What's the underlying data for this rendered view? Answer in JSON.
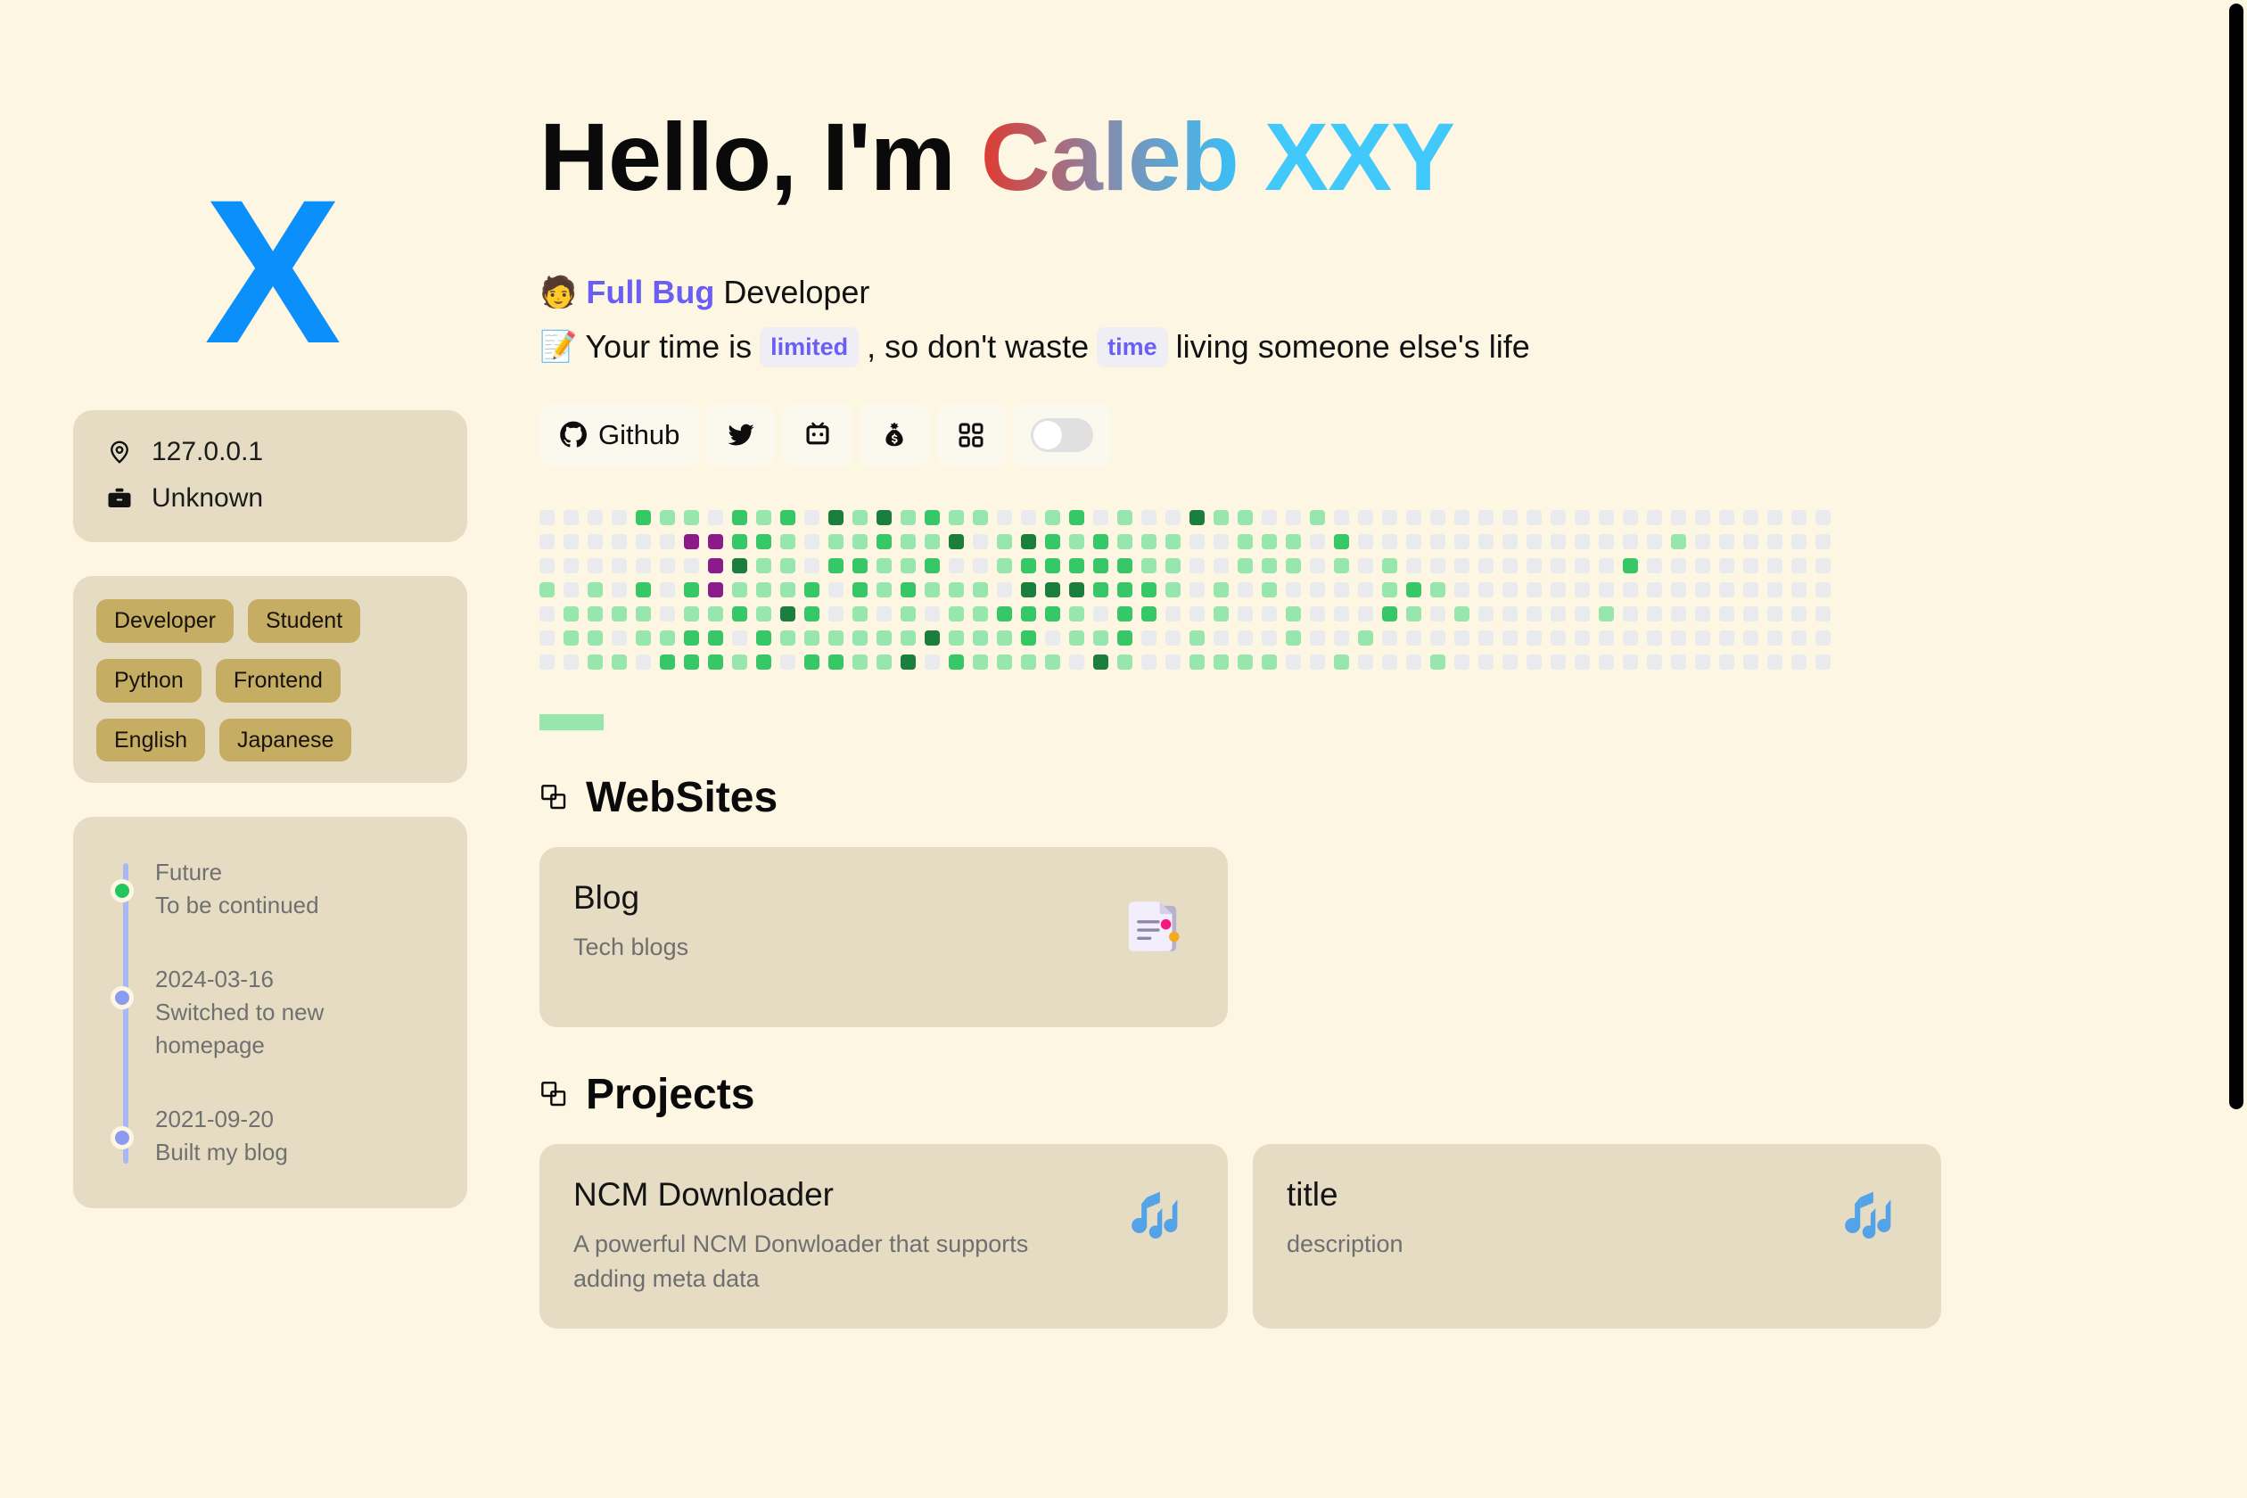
{
  "logo": {
    "text": "X",
    "color": "#0b8ffb"
  },
  "hero": {
    "greeting": "Hello, I'm ",
    "name": "Caleb",
    "handle": "XXY",
    "role_emoji": "🧑",
    "role_accent": "Full Bug",
    "role_rest": "Developer",
    "quote_emoji": "📝",
    "quote_part1": "Your time is",
    "quote_chip1": "limited",
    "quote_part2": ", so don't waste",
    "quote_chip2": "time",
    "quote_part3": "living someone else's life"
  },
  "social": {
    "items": [
      {
        "icon": "github-icon",
        "label": "Github"
      },
      {
        "icon": "twitter-icon",
        "label": ""
      },
      {
        "icon": "bilibili-icon",
        "label": ""
      },
      {
        "icon": "money-bag-icon",
        "label": ""
      },
      {
        "icon": "grid-apps-icon",
        "label": ""
      }
    ],
    "theme_toggle": {
      "icon": "theme-toggle",
      "state": "off"
    }
  },
  "info": {
    "location_icon": "location-pin-icon",
    "location": "127.0.0.1",
    "company_icon": "briefcase-icon",
    "company": "Unknown"
  },
  "tags": [
    "Developer",
    "Student",
    "Python",
    "Frontend",
    "English",
    "Japanese"
  ],
  "timeline": [
    {
      "date": "Future",
      "text": "To be continued",
      "dot": "green"
    },
    {
      "date": "2024-03-16",
      "text": "Switched to new homepage",
      "dot": "blue"
    },
    {
      "date": "2021-09-20",
      "text": "Built my blog",
      "dot": "blue"
    }
  ],
  "sections": {
    "websites": {
      "icon": "overlapping-squares-icon",
      "title": "WebSites"
    },
    "projects": {
      "icon": "overlapping-squares-icon",
      "title": "Projects"
    }
  },
  "websites": [
    {
      "title": "Blog",
      "desc": "Tech blogs",
      "icon": "document-icon"
    }
  ],
  "projects": [
    {
      "title": "NCM Downloader",
      "desc": "A powerful NCM Donwloader that supports adding meta data",
      "icon": "music-notes-icon"
    },
    {
      "title": "title",
      "desc": "description",
      "icon": "music-notes-icon"
    }
  ],
  "chart_data": {
    "type": "heatmap",
    "title": "Contribution activity heatmap",
    "rows": 7,
    "columns": 54,
    "levels": [
      0,
      1,
      2,
      3,
      4
    ],
    "level_colors": [
      "#e8eaee",
      "#97e6ad",
      "#36c767",
      "#1a7f3c",
      "#8b1a8b"
    ],
    "legend_color": "#97e6ad",
    "values": [
      [
        0,
        0,
        0,
        0,
        2,
        1,
        1,
        0,
        2,
        1,
        2,
        0,
        3,
        1,
        3,
        1,
        2,
        1,
        1,
        0,
        0,
        1,
        2,
        0,
        1,
        0,
        0,
        3,
        1,
        1,
        0,
        0,
        1,
        0,
        0,
        0,
        0,
        0,
        0,
        0,
        0,
        0,
        0,
        0,
        0,
        0,
        0,
        0,
        0,
        0,
        0,
        0,
        0,
        0
      ],
      [
        0,
        0,
        0,
        0,
        0,
        0,
        4,
        4,
        2,
        2,
        1,
        0,
        1,
        1,
        2,
        1,
        1,
        3,
        0,
        1,
        3,
        2,
        1,
        2,
        1,
        1,
        1,
        0,
        0,
        1,
        1,
        1,
        0,
        2,
        0,
        0,
        0,
        0,
        0,
        0,
        0,
        0,
        0,
        0,
        0,
        0,
        0,
        1,
        0,
        0,
        0,
        0,
        0,
        0
      ],
      [
        0,
        0,
        0,
        0,
        0,
        0,
        0,
        4,
        3,
        1,
        1,
        0,
        2,
        2,
        1,
        1,
        2,
        0,
        0,
        1,
        2,
        2,
        2,
        2,
        2,
        1,
        1,
        0,
        0,
        1,
        1,
        1,
        0,
        1,
        0,
        1,
        0,
        0,
        0,
        0,
        0,
        0,
        0,
        0,
        0,
        2,
        0,
        0,
        0,
        0,
        0,
        0,
        0,
        0
      ],
      [
        1,
        0,
        1,
        0,
        2,
        0,
        2,
        4,
        1,
        1,
        1,
        2,
        0,
        2,
        1,
        2,
        1,
        1,
        1,
        0,
        3,
        3,
        3,
        2,
        2,
        2,
        1,
        0,
        1,
        0,
        1,
        0,
        0,
        0,
        0,
        1,
        2,
        1,
        0,
        0,
        0,
        0,
        0,
        0,
        0,
        0,
        0,
        0,
        0,
        0,
        0,
        0,
        0,
        0
      ],
      [
        0,
        1,
        1,
        1,
        1,
        0,
        1,
        1,
        2,
        1,
        3,
        2,
        0,
        1,
        0,
        1,
        0,
        1,
        1,
        2,
        2,
        2,
        1,
        0,
        2,
        2,
        0,
        0,
        1,
        0,
        0,
        1,
        0,
        0,
        0,
        2,
        1,
        0,
        1,
        0,
        0,
        0,
        0,
        0,
        1,
        0,
        0,
        0,
        0,
        0,
        0,
        0,
        0,
        0
      ],
      [
        0,
        1,
        1,
        0,
        1,
        1,
        2,
        2,
        0,
        2,
        1,
        1,
        1,
        1,
        1,
        1,
        3,
        1,
        1,
        1,
        2,
        0,
        1,
        1,
        2,
        0,
        0,
        1,
        0,
        0,
        0,
        1,
        0,
        0,
        1,
        0,
        0,
        0,
        0,
        0,
        0,
        0,
        0,
        0,
        0,
        0,
        0,
        0,
        0,
        0,
        0,
        0,
        0,
        0
      ],
      [
        0,
        0,
        1,
        1,
        0,
        2,
        2,
        2,
        1,
        2,
        0,
        2,
        2,
        1,
        1,
        3,
        0,
        2,
        1,
        1,
        1,
        1,
        0,
        3,
        1,
        0,
        0,
        1,
        1,
        1,
        1,
        0,
        0,
        1,
        0,
        0,
        0,
        1,
        0,
        0,
        0,
        0,
        0,
        0,
        0,
        0,
        0,
        0,
        0,
        0,
        0,
        0,
        0,
        0
      ]
    ]
  }
}
